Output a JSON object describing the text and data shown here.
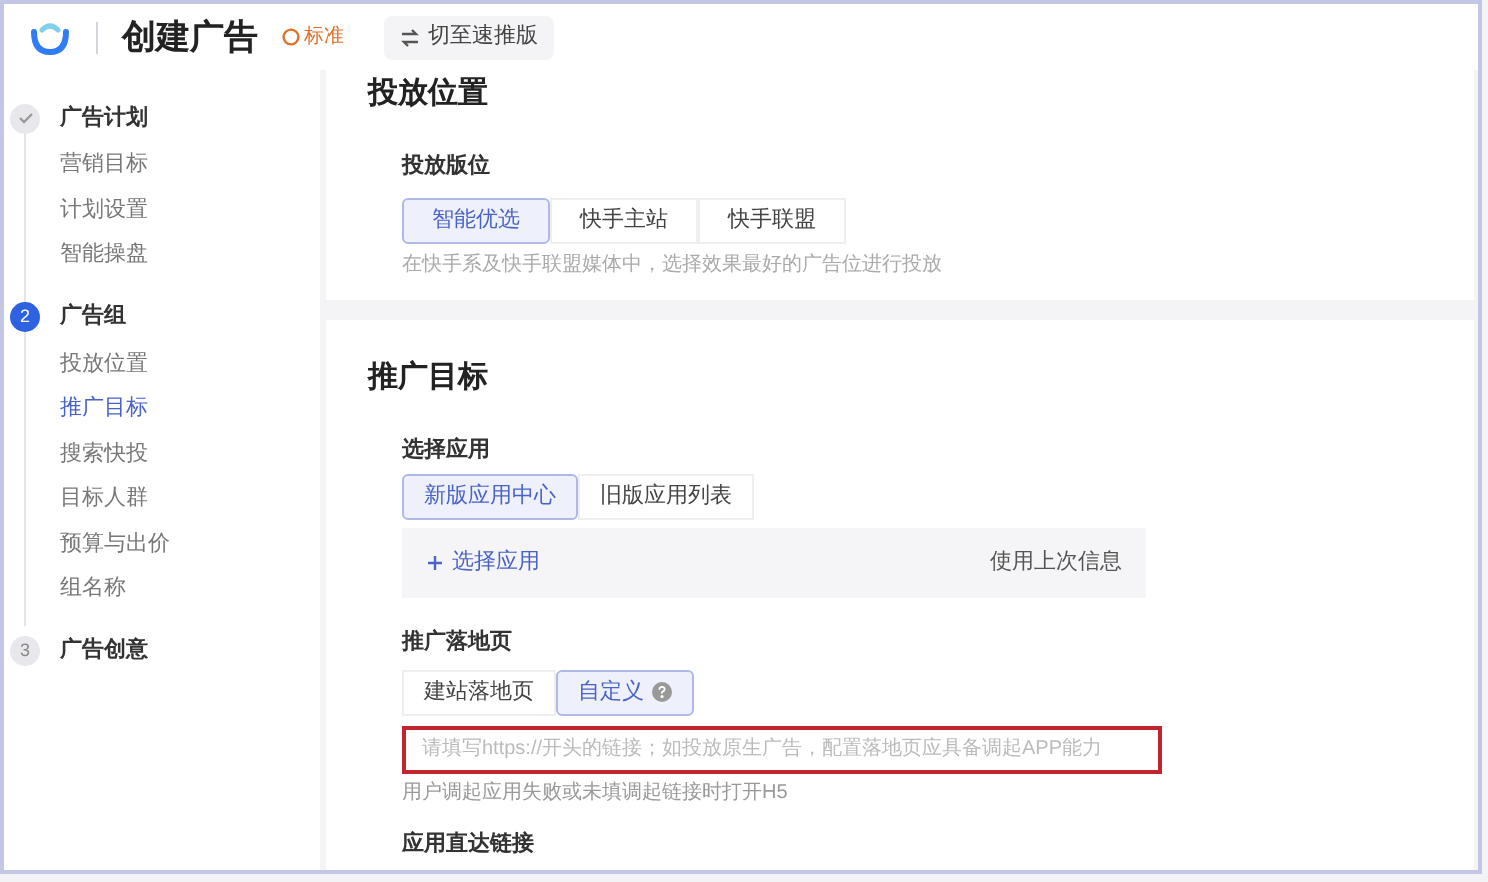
{
  "header": {
    "title": "创建广告",
    "badge": "标准",
    "switch_button": "切至速推版"
  },
  "steps": [
    {
      "done": true,
      "current": false,
      "label": "广告计划",
      "items": [
        {
          "label": "营销目标",
          "selected": false
        },
        {
          "label": "计划设置",
          "selected": false
        },
        {
          "label": "智能操盘",
          "selected": false
        }
      ]
    },
    {
      "done": false,
      "current": true,
      "number": "2",
      "label": "广告组",
      "items": [
        {
          "label": "投放位置",
          "selected": false
        },
        {
          "label": "推广目标",
          "selected": true
        },
        {
          "label": "搜索快投",
          "selected": false
        },
        {
          "label": "目标人群",
          "selected": false
        },
        {
          "label": "预算与出价",
          "selected": false
        },
        {
          "label": "组名称",
          "selected": false
        }
      ]
    },
    {
      "done": false,
      "current": false,
      "number": "3",
      "label": "广告创意"
    }
  ],
  "placement": {
    "title": "投放位置",
    "label": "投放版位",
    "options": [
      {
        "label": "智能优选",
        "selected": true
      },
      {
        "label": "快手主站",
        "selected": false
      },
      {
        "label": "快手联盟",
        "selected": false
      }
    ],
    "hint": "在快手系及快手联盟媒体中，选择效果最好的广告位进行投放"
  },
  "goal": {
    "title": "推广目标",
    "app_label": "选择应用",
    "app_options": [
      {
        "label": "新版应用中心",
        "selected": true
      },
      {
        "label": "旧版应用列表",
        "selected": false
      }
    ],
    "add_app": "选择应用",
    "use_last": "使用上次信息",
    "landing_label": "推广落地页",
    "landing_options": [
      {
        "label": "建站落地页",
        "selected": false,
        "help": false
      },
      {
        "label": "自定义",
        "selected": true,
        "help": true
      }
    ],
    "url_field": {
      "placeholder": "请填写https://开头的链接；如投放原生广告，配置落地页应具备调起APP能力",
      "highlighted": true
    },
    "url_hint": "用户调起应用失败或未填调起链接时打开H5",
    "deeplink_label": "应用直达链接"
  }
}
